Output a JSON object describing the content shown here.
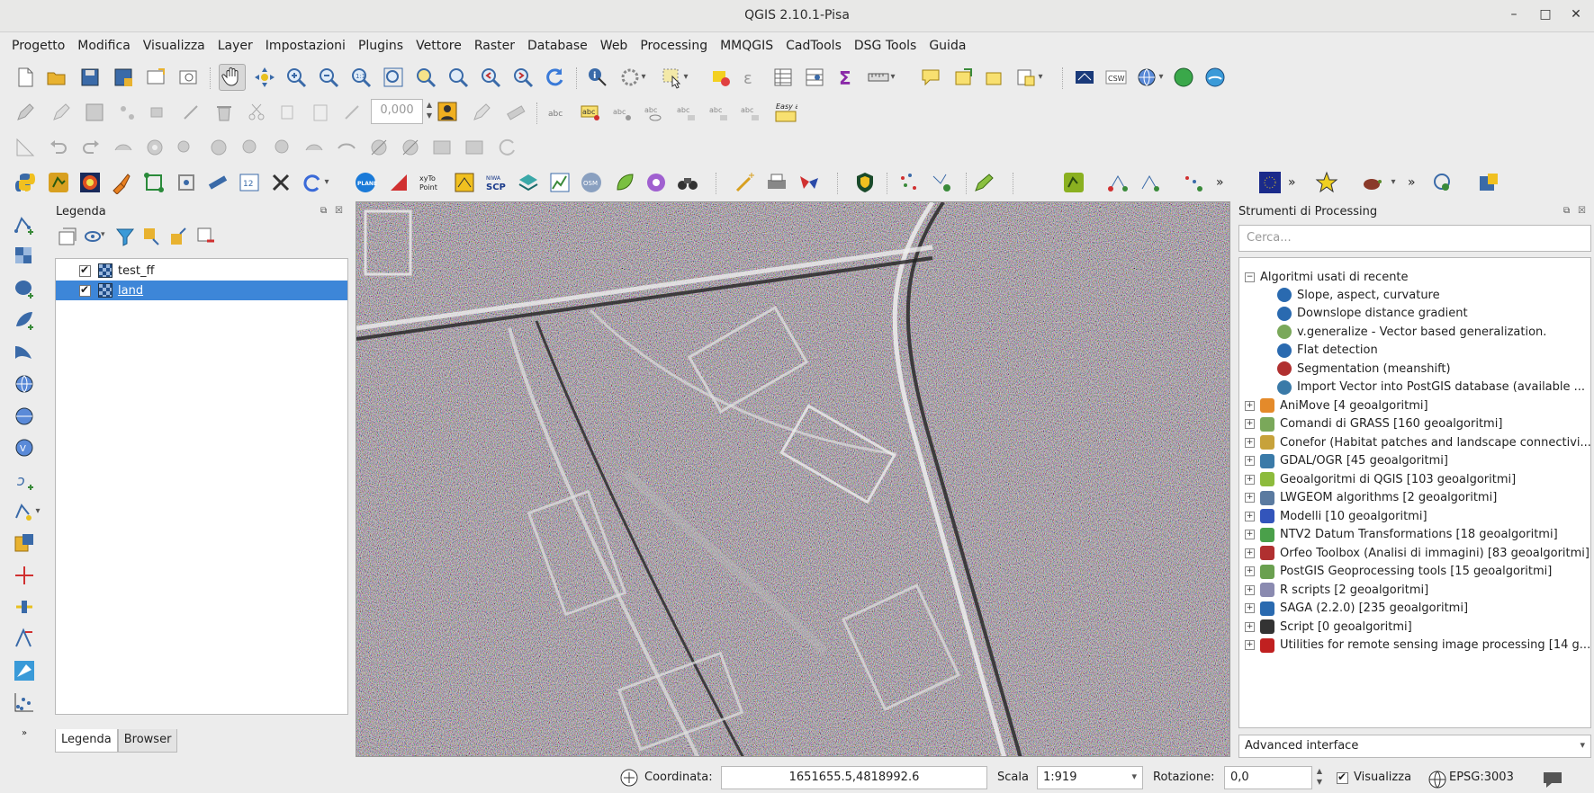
{
  "window": {
    "title": "QGIS 2.10.1-Pisa"
  },
  "menu": [
    "Progetto",
    "Modifica",
    "Visualizza",
    "Layer",
    "Impostazioni",
    "Plugins",
    "Vettore",
    "Raster",
    "Database",
    "Web",
    "Processing",
    "MMQGIS",
    "CadTools",
    "DSG Tools",
    "Guida"
  ],
  "toolbar": {
    "rotation_value": "0,000",
    "toolbar_labels": [
      "xyTo Point",
      "NIWA SCP",
      "CSW",
      "Easy abc"
    ]
  },
  "legend": {
    "title": "Legenda",
    "layers": [
      {
        "name": "test_ff",
        "checked": true,
        "selected": false
      },
      {
        "name": "land",
        "checked": true,
        "selected": true
      }
    ],
    "tabs": [
      "Legenda",
      "Browser"
    ],
    "active_tab": "Legenda"
  },
  "processing": {
    "title": "Strumenti di Processing",
    "search_placeholder": "Cerca...",
    "recent_group": "Algoritmi usati di recente",
    "recent": [
      {
        "label": "Slope, aspect, curvature",
        "icon": "saga-icon"
      },
      {
        "label": "Downslope distance gradient",
        "icon": "saga-icon"
      },
      {
        "label": "v.generalize - Vector based generalization.",
        "icon": "grass-icon"
      },
      {
        "label": "Flat detection",
        "icon": "saga-icon"
      },
      {
        "label": "Segmentation (meanshift)",
        "icon": "otb-icon"
      },
      {
        "label": "Import Vector into PostGIS database (available ...",
        "icon": "gdal-icon"
      }
    ],
    "providers": [
      {
        "label": "AniMove [4 geoalgoritmi]",
        "color": "#e48a2a"
      },
      {
        "label": "Comandi di GRASS [160 geoalgoritmi]",
        "color": "#7aa85a"
      },
      {
        "label": "Conefor (Habitat patches and landscape connectivi...",
        "color": "#c7a23b"
      },
      {
        "label": "GDAL/OGR [45 geoalgoritmi]",
        "color": "#3a7aa8"
      },
      {
        "label": "Geoalgoritmi di QGIS [103 geoalgoritmi]",
        "color": "#8dbb3c"
      },
      {
        "label": "LWGEOM algorithms [2 geoalgoritmi]",
        "color": "#5a7aa0"
      },
      {
        "label": "Modelli [10 geoalgoritmi]",
        "color": "#3355bb"
      },
      {
        "label": "NTV2 Datum Transformations [18 geoalgoritmi]",
        "color": "#4aa04a"
      },
      {
        "label": "Orfeo Toolbox (Analisi di immagini) [83 geoalgoritmi]",
        "color": "#b03030"
      },
      {
        "label": "PostGIS Geoprocessing tools [15 geoalgoritmi]",
        "color": "#6aa050"
      },
      {
        "label": "R scripts [2 geoalgoritmi]",
        "color": "#8a8ab0"
      },
      {
        "label": "SAGA (2.2.0) [235 geoalgoritmi]",
        "color": "#2a6ab0"
      },
      {
        "label": "Script [0 geoalgoritmi]",
        "color": "#333333"
      },
      {
        "label": "Utilities for remote sensing image processing [14 g...",
        "color": "#c02020"
      }
    ],
    "interface_mode": "Advanced interface"
  },
  "status": {
    "coord_label": "Coordinata:",
    "coord_value": "1651655.5,4818992.6",
    "scale_label": "Scala",
    "scale_value": "1:919",
    "rotation_label": "Rotazione:",
    "rotation_value": "0,0",
    "render_label": "Visualizza",
    "render_checked": true,
    "crs": "EPSG:3003"
  },
  "colors": {
    "selection": "#3d86d8",
    "background": "#ececec"
  }
}
